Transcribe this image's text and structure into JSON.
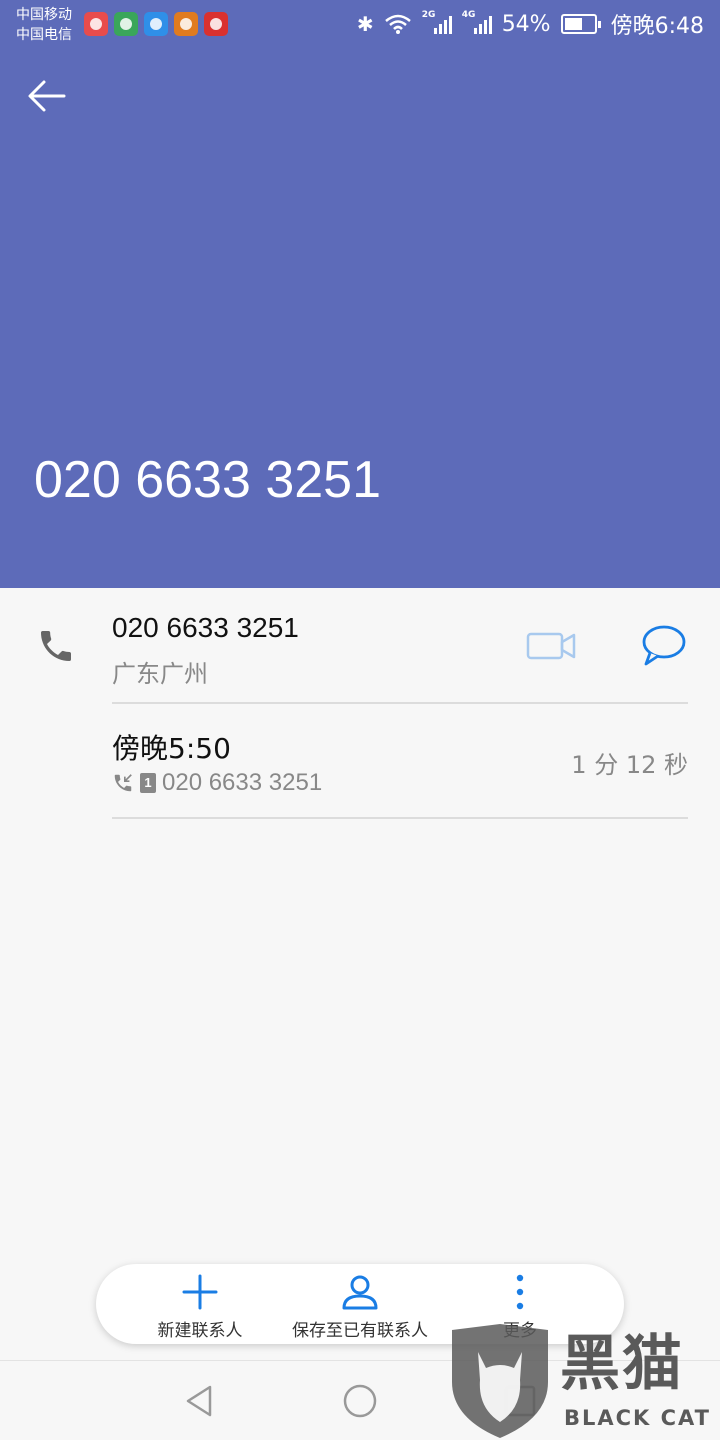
{
  "status_bar": {
    "carrier_1": "中国移动",
    "carrier_2": "中国电信",
    "app_icons": [
      {
        "name": "map-app-icon",
        "color": "#e84c4c"
      },
      {
        "name": "browser-app-icon",
        "color": "#3aa65a"
      },
      {
        "name": "qq-browser-app-icon",
        "color": "#2f8fe8"
      },
      {
        "name": "game-app-icon",
        "color": "#e07b20"
      },
      {
        "name": "weibo-app-icon",
        "color": "#d9312f"
      }
    ],
    "sim1_network": "2G",
    "sim2_network": "4G",
    "battery": "54%",
    "time": "傍晚6:48"
  },
  "header": {
    "color": "#5d6bb9",
    "title": "020 6633 3251"
  },
  "contact": {
    "number": "020 6633 3251",
    "location": "广东广州"
  },
  "call_log": [
    {
      "time": "傍晚5:50",
      "sim": "1",
      "number": "020 6633 3251",
      "duration": "1 分 12 秒"
    }
  ],
  "actions": {
    "new_contact": "新建联系人",
    "save_existing": "保存至已有联系人",
    "more": "更多"
  },
  "watermark": {
    "text": "黑猫",
    "sub": "BLACK CAT"
  },
  "colors": {
    "accent": "#1a7de4",
    "video_disabled": "#a8c9ee"
  }
}
